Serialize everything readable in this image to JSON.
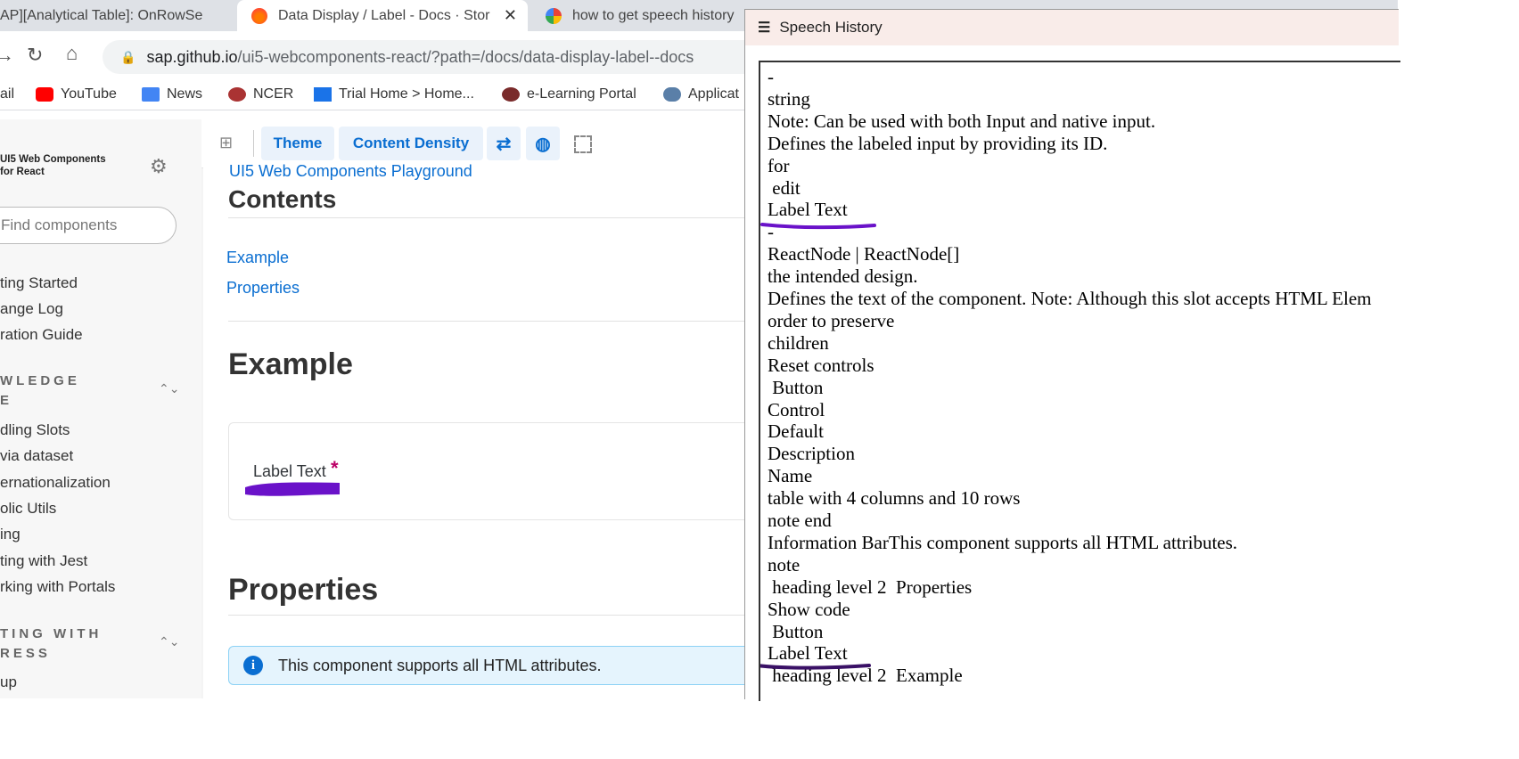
{
  "browser": {
    "tabs": [
      {
        "title": "AP][Analytical Table]: OnRowSe",
        "active": false
      },
      {
        "title": "Data Display / Label - Docs · Stor",
        "active": true
      },
      {
        "title": "how to get speech history",
        "active": false
      }
    ],
    "url": {
      "host": "sap.github.io",
      "path": "/ui5-webcomponents-react/?path=/docs/data-display-label--docs"
    },
    "bookmarks": [
      "ail",
      "YouTube",
      "News",
      "NCER",
      "Trial Home > Home...",
      "e-Learning Portal",
      "Applicat"
    ]
  },
  "sidebar": {
    "brand_line1": "UI5 Web Components",
    "brand_line2": "for React",
    "search_placeholder": "Find components",
    "links_top": [
      "ting Started",
      "ange Log",
      "ration Guide"
    ],
    "section1": "WLEDGE\nE",
    "links_mid": [
      "dling Slots",
      "via dataset",
      "ernationalization",
      "olic Utils",
      "ing",
      "ting with Jest",
      "rking with Portals"
    ],
    "section2": "TING WITH\nRESS",
    "links_bottom": [
      "up"
    ]
  },
  "main": {
    "toolbar": {
      "theme": "Theme",
      "density": "Content Density"
    },
    "playground_link": "UI5 Web Components Playground",
    "contents_heading": "Contents",
    "contents_links": [
      "Example",
      "Properties"
    ],
    "example_heading": "Example",
    "label_text": "Label Text",
    "required_mark": "*",
    "properties_heading": "Properties",
    "info_text": "This component supports all HTML attributes."
  },
  "speech_history": {
    "title": "Speech History",
    "lines": [
      "-",
      "string",
      "Note: Can be used with both Input and native input.",
      "Defines the labeled input by providing its ID.",
      "for",
      " edit",
      "Label Text",
      "-",
      "ReactNode | ReactNode[]",
      "the intended design.",
      "Defines the text of the component. Note: Although this slot accepts HTML Elem",
      "order to preserve",
      "children",
      "Reset controls",
      " Button",
      "Control",
      "Default",
      "Description",
      "Name",
      "table with 4 columns and 10 rows",
      "note end",
      "Information BarThis component supports all HTML attributes.",
      "note",
      " heading level 2  Properties",
      "Show code",
      " Button",
      "Label Text",
      " heading level 2  Example"
    ]
  },
  "colors": {
    "accent": "#0a6ed1",
    "annotation_purple": "#6a12c9",
    "speech_title_bg": "#f9ece9"
  }
}
